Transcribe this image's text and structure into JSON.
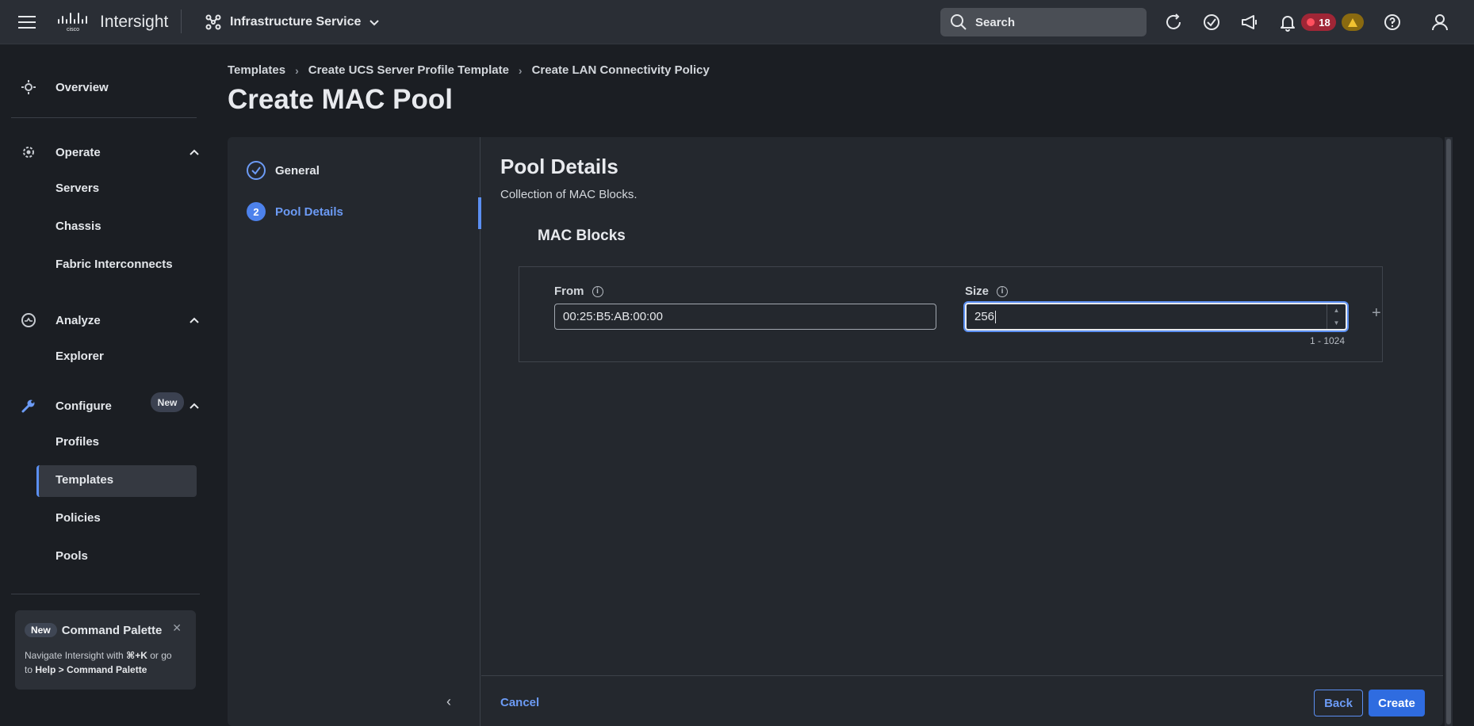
{
  "topbar": {
    "app_name": "Intersight",
    "service": "Infrastructure Service",
    "search_label": "Search",
    "critical_count": "18",
    "colors": {
      "critical": "#a02636",
      "warning": "#8a6a10",
      "accent": "#5b8ff2"
    }
  },
  "sidebar": {
    "overview": "Overview",
    "operate": {
      "label": "Operate",
      "items": [
        "Servers",
        "Chassis",
        "Fabric Interconnects"
      ]
    },
    "analyze": {
      "label": "Analyze",
      "items": [
        "Explorer"
      ],
      "new_badge": "New"
    },
    "configure": {
      "label": "Configure",
      "items": [
        "Profiles",
        "Templates",
        "Policies",
        "Pools"
      ],
      "active": "Templates"
    },
    "command_palette": {
      "badge": "New",
      "title": "Command Palette",
      "line1_pre": "Navigate Intersight with ",
      "shortcut": "⌘+K",
      "line1_post": " or go",
      "line2_pre": "to ",
      "path": "Help > Command Palette"
    }
  },
  "breadcrumb": [
    "Templates",
    "Create UCS Server Profile Template",
    "Create LAN Connectivity Policy"
  ],
  "page_title": "Create MAC Pool",
  "steps": [
    {
      "label": "General",
      "state": "done"
    },
    {
      "number": "2",
      "label": "Pool Details",
      "state": "current"
    }
  ],
  "pool_details": {
    "title": "Pool Details",
    "subtitle": "Collection of MAC Blocks.",
    "blocks_title": "MAC Blocks",
    "from_label": "From",
    "from_value": "00:25:B5:AB:00:00",
    "size_label": "Size",
    "size_value": "256",
    "size_range": "1 - 1024"
  },
  "footer": {
    "cancel": "Cancel",
    "back": "Back",
    "create": "Create"
  }
}
